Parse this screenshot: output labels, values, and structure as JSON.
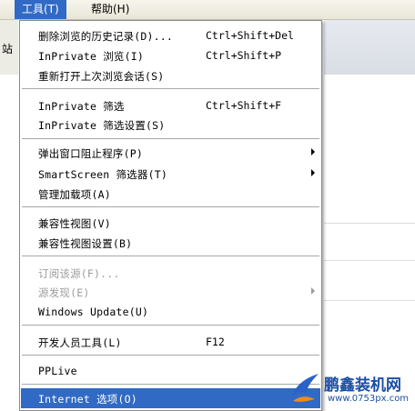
{
  "menubar": {
    "tools": "工具(T)",
    "help": "帮助(H)"
  },
  "background": {
    "fragment": "站"
  },
  "menu": {
    "items": [
      {
        "label": "删除浏览的历史记录(D)...",
        "shortcut": "Ctrl+Shift+Del"
      },
      {
        "label": "InPrivate 浏览(I)",
        "shortcut": "Ctrl+Shift+P"
      },
      {
        "label": "重新打开上次浏览会话(S)",
        "shortcut": ""
      },
      {
        "label": "InPrivate 筛选",
        "shortcut": "Ctrl+Shift+F"
      },
      {
        "label": "InPrivate 筛选设置(S)",
        "shortcut": ""
      },
      {
        "label": "弹出窗口阻止程序(P)",
        "shortcut": ""
      },
      {
        "label": "SmartScreen 筛选器(T)",
        "shortcut": ""
      },
      {
        "label": "管理加载项(A)",
        "shortcut": ""
      },
      {
        "label": "兼容性视图(V)",
        "shortcut": ""
      },
      {
        "label": "兼容性视图设置(B)",
        "shortcut": ""
      },
      {
        "label": "订阅该源(F)...",
        "shortcut": ""
      },
      {
        "label": "源发现(E)",
        "shortcut": ""
      },
      {
        "label": "Windows Update(U)",
        "shortcut": ""
      },
      {
        "label": "开发人员工具(L)",
        "shortcut": "F12"
      },
      {
        "label": "PPLive",
        "shortcut": ""
      },
      {
        "label": "Internet 选项(O)",
        "shortcut": ""
      }
    ]
  },
  "watermark": {
    "name": "鹏鑫装机网",
    "url": "www.0753px.com"
  },
  "colors": {
    "highlight": "#316ac5",
    "disabled_text": "#9d9d9d"
  }
}
